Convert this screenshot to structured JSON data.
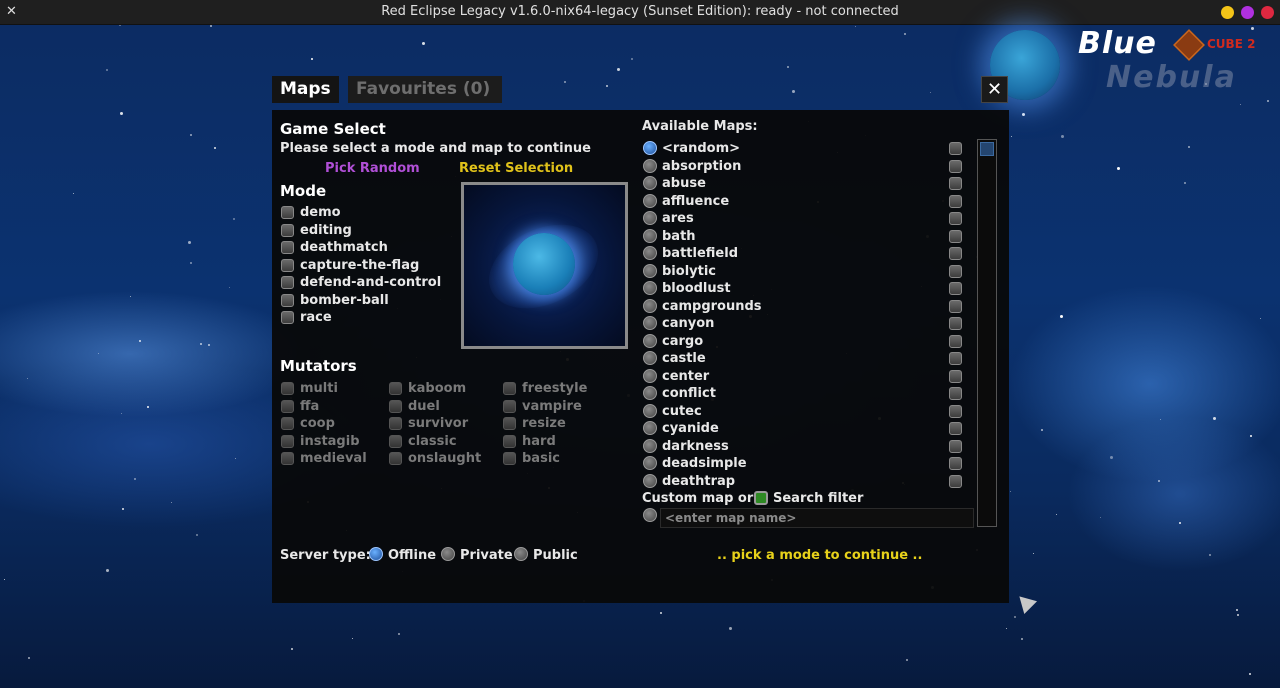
{
  "window": {
    "title": "Red Eclipse Legacy v1.6.0-nix64-legacy (Sunset Edition): ready - not connected",
    "app_icon": "x-icon",
    "controls": [
      {
        "name": "minimize",
        "color": "#f5c518"
      },
      {
        "name": "maximize",
        "color": "#b030e0"
      },
      {
        "name": "close",
        "color": "#e02840"
      }
    ]
  },
  "logo": {
    "line1": "Blue",
    "badge": "CUBE 2",
    "line2": "Nebula"
  },
  "tabs": [
    {
      "label": "Maps",
      "active": true
    },
    {
      "label": "Favourites (0)",
      "active": false
    }
  ],
  "close_glyph": "✕",
  "game_select": {
    "title": "Game Select",
    "instructions": "Please select a mode and map to continue",
    "pick_random": "Pick Random",
    "reset_selection": "Reset Selection"
  },
  "mode": {
    "title": "Mode",
    "items": [
      "demo",
      "editing",
      "deathmatch",
      "capture-the-flag",
      "defend-and-control",
      "bomber-ball",
      "race"
    ]
  },
  "mutators": {
    "title": "Mutators",
    "col1": [
      "multi",
      "ffa",
      "coop",
      "instagib",
      "medieval"
    ],
    "col2": [
      "kaboom",
      "duel",
      "survivor",
      "classic",
      "onslaught"
    ],
    "col3": [
      "freestyle",
      "vampire",
      "resize",
      "hard",
      "basic"
    ]
  },
  "maps": {
    "title": "Available Maps:",
    "items": [
      "<random>",
      "absorption",
      "abuse",
      "affluence",
      "ares",
      "bath",
      "battlefield",
      "biolytic",
      "bloodlust",
      "campgrounds",
      "canyon",
      "cargo",
      "castle",
      "center",
      "conflict",
      "cutec",
      "cyanide",
      "darkness",
      "deadsimple",
      "deathtrap"
    ],
    "selected_index": 0,
    "custom_label": "Custom map or",
    "search_filter_label": "Search filter",
    "custom_placeholder": "<enter map name>"
  },
  "server": {
    "label": "Server type:",
    "options": [
      "Offline",
      "Private",
      "Public"
    ],
    "selected": "Offline"
  },
  "status": ".. pick a mode to continue ..",
  "colors": {
    "pick_random": "#b04fd6",
    "reset_selection": "#e0c21a",
    "status": "#e8d21a"
  }
}
